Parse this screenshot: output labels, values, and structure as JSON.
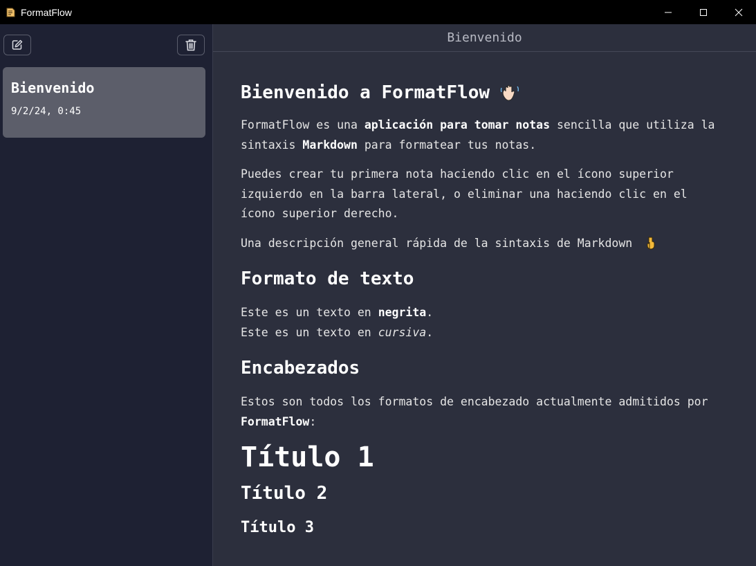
{
  "window": {
    "title": "FormatFlow"
  },
  "sidebar": {
    "new_note_icon": "edit-icon",
    "delete_icon": "trash-icon",
    "notes": [
      {
        "title": "Bienvenido",
        "date": "9/2/24, 0:45"
      }
    ]
  },
  "main": {
    "header_title": "Bienvenido",
    "h1_text": "Bienvenido a FormatFlow",
    "p1": {
      "a": "FormatFlow es una ",
      "b": "aplicación para tomar notas",
      "c": " sencilla que utiliza la sintaxis ",
      "d": "Markdown",
      "e": " para formatear tus notas."
    },
    "p2": "Puedes crear tu primera nota haciendo clic en el ícono superior izquierdo en la barra lateral, o eliminar una haciendo clic en el ícono superior derecho.",
    "p3": "Una descripción general rápida de la sintaxis de Markdown",
    "h2_format": "Formato de texto",
    "bold_line": {
      "a": "Este es un texto en ",
      "b": "negrita",
      "c": "."
    },
    "italic_line": {
      "a": "Este es un texto en ",
      "b": "cursiva",
      "c": "."
    },
    "h2_headers": "Encabezados",
    "p_headers": {
      "a": "Estos son todos los formatos de encabezado actualmente admitidos por ",
      "b": "FormatFlow",
      "c": ":"
    },
    "titulo1": "Título 1",
    "titulo2": "Título 2",
    "titulo3": "Título 3"
  },
  "colors": {
    "titlebar": "#000000",
    "sidebar_bg": "#1e2133",
    "main_bg": "#2c2f3d",
    "note_card_bg": "#5c5e6a"
  }
}
